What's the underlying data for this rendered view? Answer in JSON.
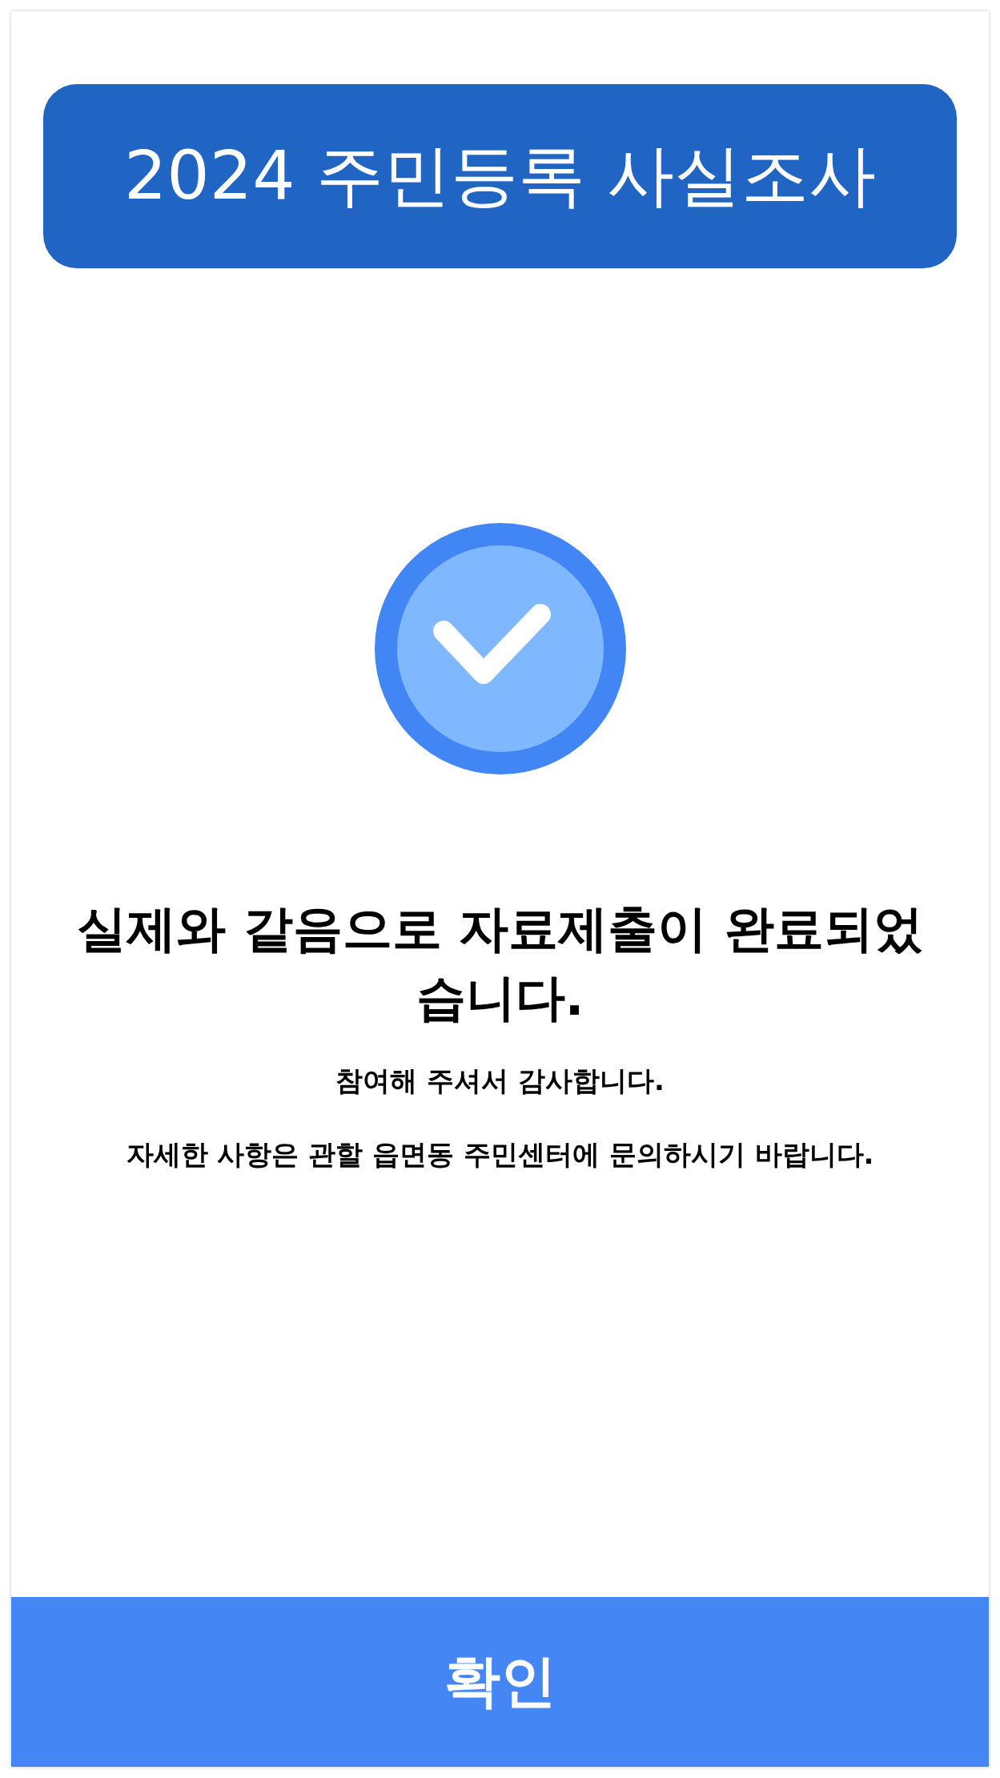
{
  "header": {
    "title": "2024 주민등록 사실조사"
  },
  "message": {
    "heading": "실제와 같음으로 자료제출이 완료되었습니다.",
    "thanks": "참여해 주셔서 감사합니다.",
    "notice": "자세한 사항은 관할 읍면동 주민센터에 문의하시기 바랍니다."
  },
  "confirm_button": {
    "label": "확인"
  }
}
